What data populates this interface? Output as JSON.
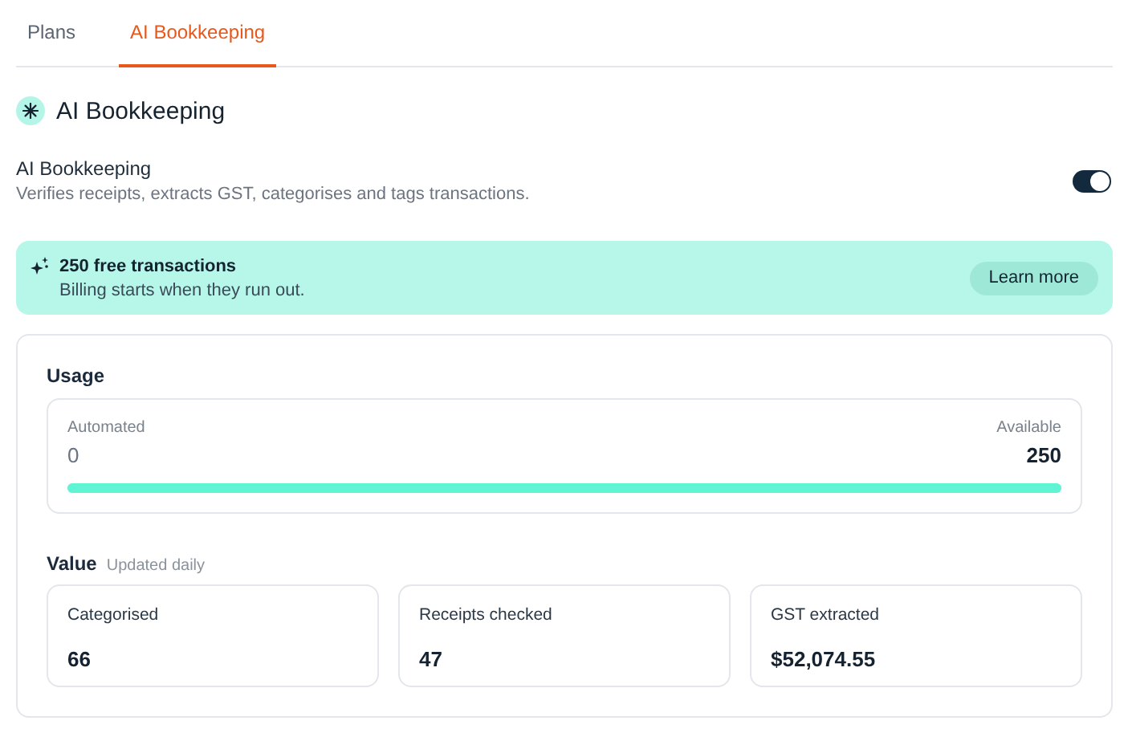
{
  "tabs": [
    {
      "label": "Plans",
      "selected": false
    },
    {
      "label": "AI Bookkeeping",
      "selected": true
    }
  ],
  "heading": "AI Bookkeeping",
  "setting": {
    "title": "AI Bookkeeping",
    "description": "Verifies receipts, extracts GST, categorises and tags transactions.",
    "on": true
  },
  "banner": {
    "title": "250 free transactions",
    "subtitle": "Billing starts when they run out.",
    "button": "Learn more"
  },
  "usage": {
    "title": "Usage",
    "left_label": "Automated",
    "left_value": "0",
    "right_label": "Available",
    "right_value": "250",
    "level": 1
  },
  "value": {
    "title": "Value",
    "note": "Updated daily",
    "cards": [
      {
        "label": "Categorised",
        "value": "66"
      },
      {
        "label": "Receipts checked",
        "value": "47"
      },
      {
        "label": "GST extracted",
        "value": "$52,074.55"
      }
    ]
  }
}
